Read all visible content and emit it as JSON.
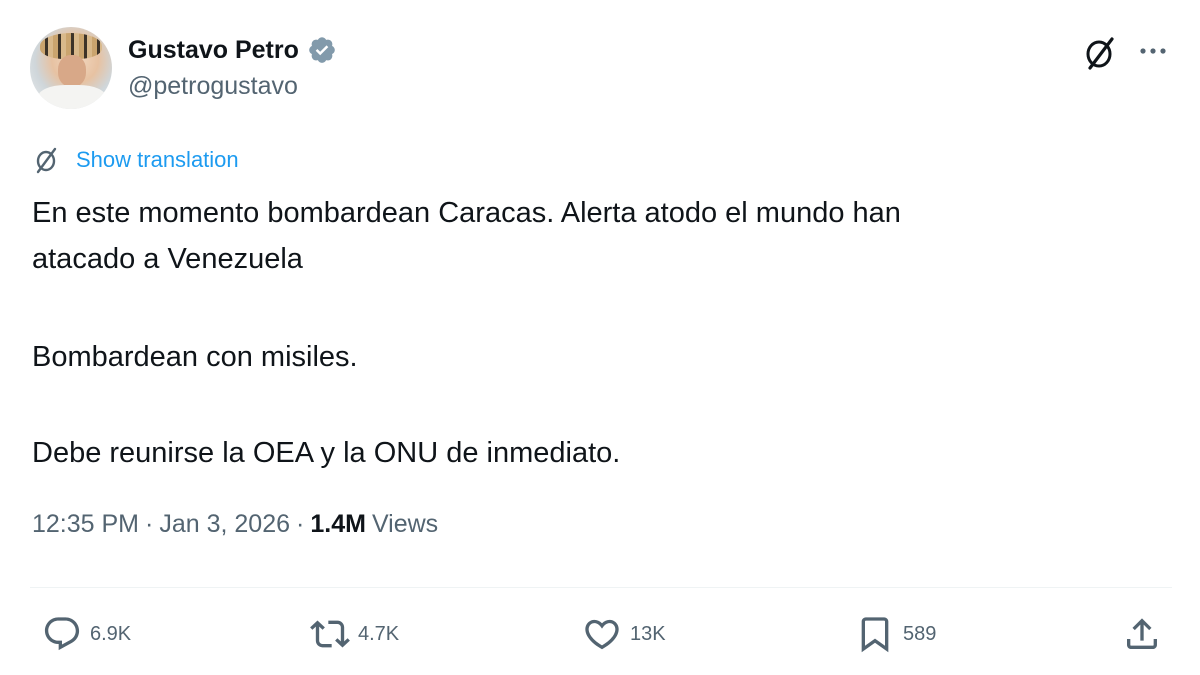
{
  "author": {
    "name": "Gustavo Petro",
    "handle": "@petrogustavo",
    "verified_color": "#829aab"
  },
  "translation": {
    "label": "Show translation",
    "color": "#1d9bf0"
  },
  "tweet": {
    "line1": "En este momento bombardean Caracas. Alerta atodo el mundo han",
    "line2": "atacado a Venezuela",
    "line3": "Bombardean con misiles.",
    "line4": "Debe reunirse la OEA y la ONU de inmediato."
  },
  "meta": {
    "time": "12:35 PM",
    "separator": "·",
    "date": "Jan 3, 2026",
    "views_count": "1.4M",
    "views_label": "Views"
  },
  "actions": {
    "replies": "6.9K",
    "reposts": "4.7K",
    "likes": "13K",
    "bookmarks": "589"
  },
  "icons": {
    "grok": "grok-icon",
    "more": "more-icon",
    "reply": "reply-icon",
    "repost": "repost-icon",
    "like": "heart-icon",
    "bookmark": "bookmark-icon",
    "share": "share-icon"
  }
}
